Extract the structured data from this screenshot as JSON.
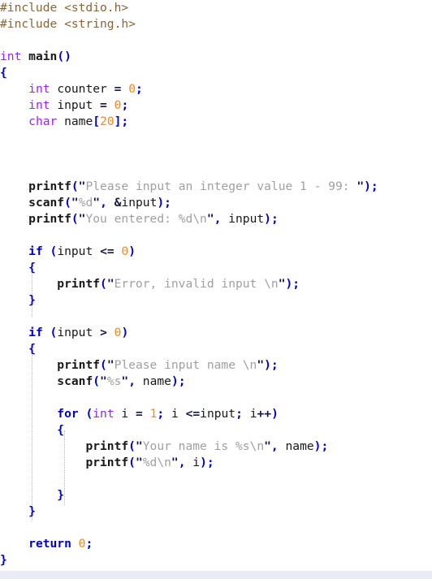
{
  "editor": {
    "language": "C",
    "font_size_px": 14.6,
    "line_height_px": 20,
    "background": "#ffffff",
    "current_line_highlight_color": "#ebebf7",
    "indent_guide_color": "#b9b9c4",
    "palette": {
      "preprocessor": "#8a6535",
      "type": "#a020f0",
      "keyword": "#0000cd",
      "number": "#ef8a20",
      "punctuation": "#0000cd",
      "operator": "#181848",
      "string": "#a0a0a0",
      "quote": "#181848",
      "identifier": "#181818"
    }
  },
  "code": {
    "lines": [
      "#include <stdio.h>",
      "#include <string.h>",
      "",
      "int main()",
      "{",
      "    int counter = 0;",
      "    int input = 0;",
      "    char name[20];",
      "",
      "",
      "",
      "    printf(\"Please input an integer value 1 - 99: \");",
      "    scanf(\"%d\", &input);",
      "    printf(\"You entered: %d\\n\", input);",
      "",
      "    if (input <= 0)",
      "    {",
      "        printf(\"Error, invalid input \\n\");",
      "    }",
      "",
      "    if (input > 0)",
      "    {",
      "        printf(\"Please input name \\n\");",
      "        scanf(\"%s\", name);",
      "",
      "        for (int i = 1; i <=input; i++)",
      "        {",
      "            printf(\"Your name is %s\\n\", name);",
      "            printf(\"%d\\n\", i);",
      "",
      "        }",
      "    }",
      "",
      "    return 0;",
      "}"
    ],
    "strings": [
      "Please input an integer value 1 - 99: ",
      "%d",
      "You entered: %d\\n",
      "Error, invalid input \\n",
      "Please input name \\n",
      "%s",
      "Your name is %s\\n",
      "%d\\n"
    ],
    "includes": [
      "#include <stdio.h>",
      "#include <string.h>"
    ],
    "functions_called": [
      "printf",
      "scanf"
    ],
    "keywords": [
      "int",
      "main",
      "char",
      "if",
      "for",
      "return"
    ],
    "identifiers": [
      "counter",
      "input",
      "name",
      "i"
    ],
    "numbers": [
      "0",
      "0",
      "20",
      "0",
      "0",
      "1",
      "0"
    ]
  }
}
